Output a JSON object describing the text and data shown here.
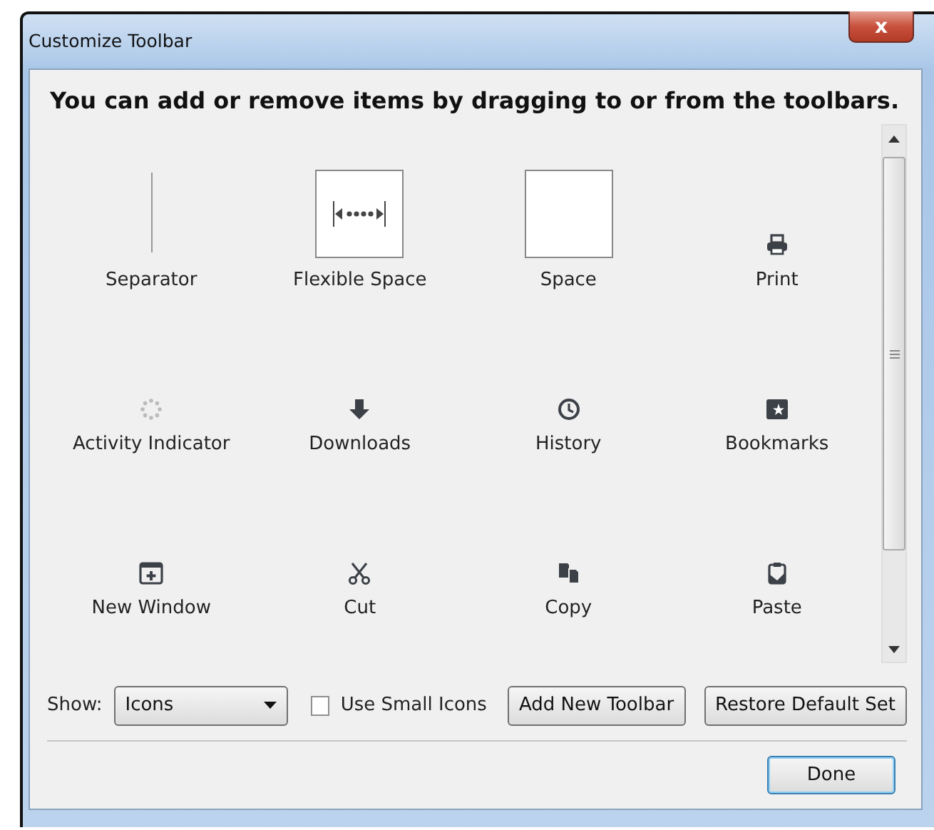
{
  "window": {
    "title": "Customize Toolbar",
    "close_button": "x"
  },
  "instructions": "You can add or remove items by dragging to or from the toolbars.",
  "items": [
    {
      "kind": "separator",
      "label": "Separator"
    },
    {
      "kind": "flexible-space",
      "label": "Flexible Space"
    },
    {
      "kind": "space",
      "label": "Space"
    },
    {
      "kind": "button",
      "label": "Print"
    },
    {
      "kind": "spinner",
      "label": "Activity Indicator"
    },
    {
      "kind": "button",
      "label": "Downloads"
    },
    {
      "kind": "button",
      "label": "History"
    },
    {
      "kind": "button",
      "label": "Bookmarks"
    },
    {
      "kind": "button",
      "label": "New Window"
    },
    {
      "kind": "button",
      "label": "Cut"
    },
    {
      "kind": "button",
      "label": "Copy"
    },
    {
      "kind": "button",
      "label": "Paste"
    }
  ],
  "show": {
    "label": "Show:",
    "value": "Icons"
  },
  "small_icons": {
    "label": "Use Small Icons",
    "checked": false
  },
  "buttons": [
    "Add New Toolbar",
    "Restore Default Set"
  ],
  "done_button": "Done"
}
